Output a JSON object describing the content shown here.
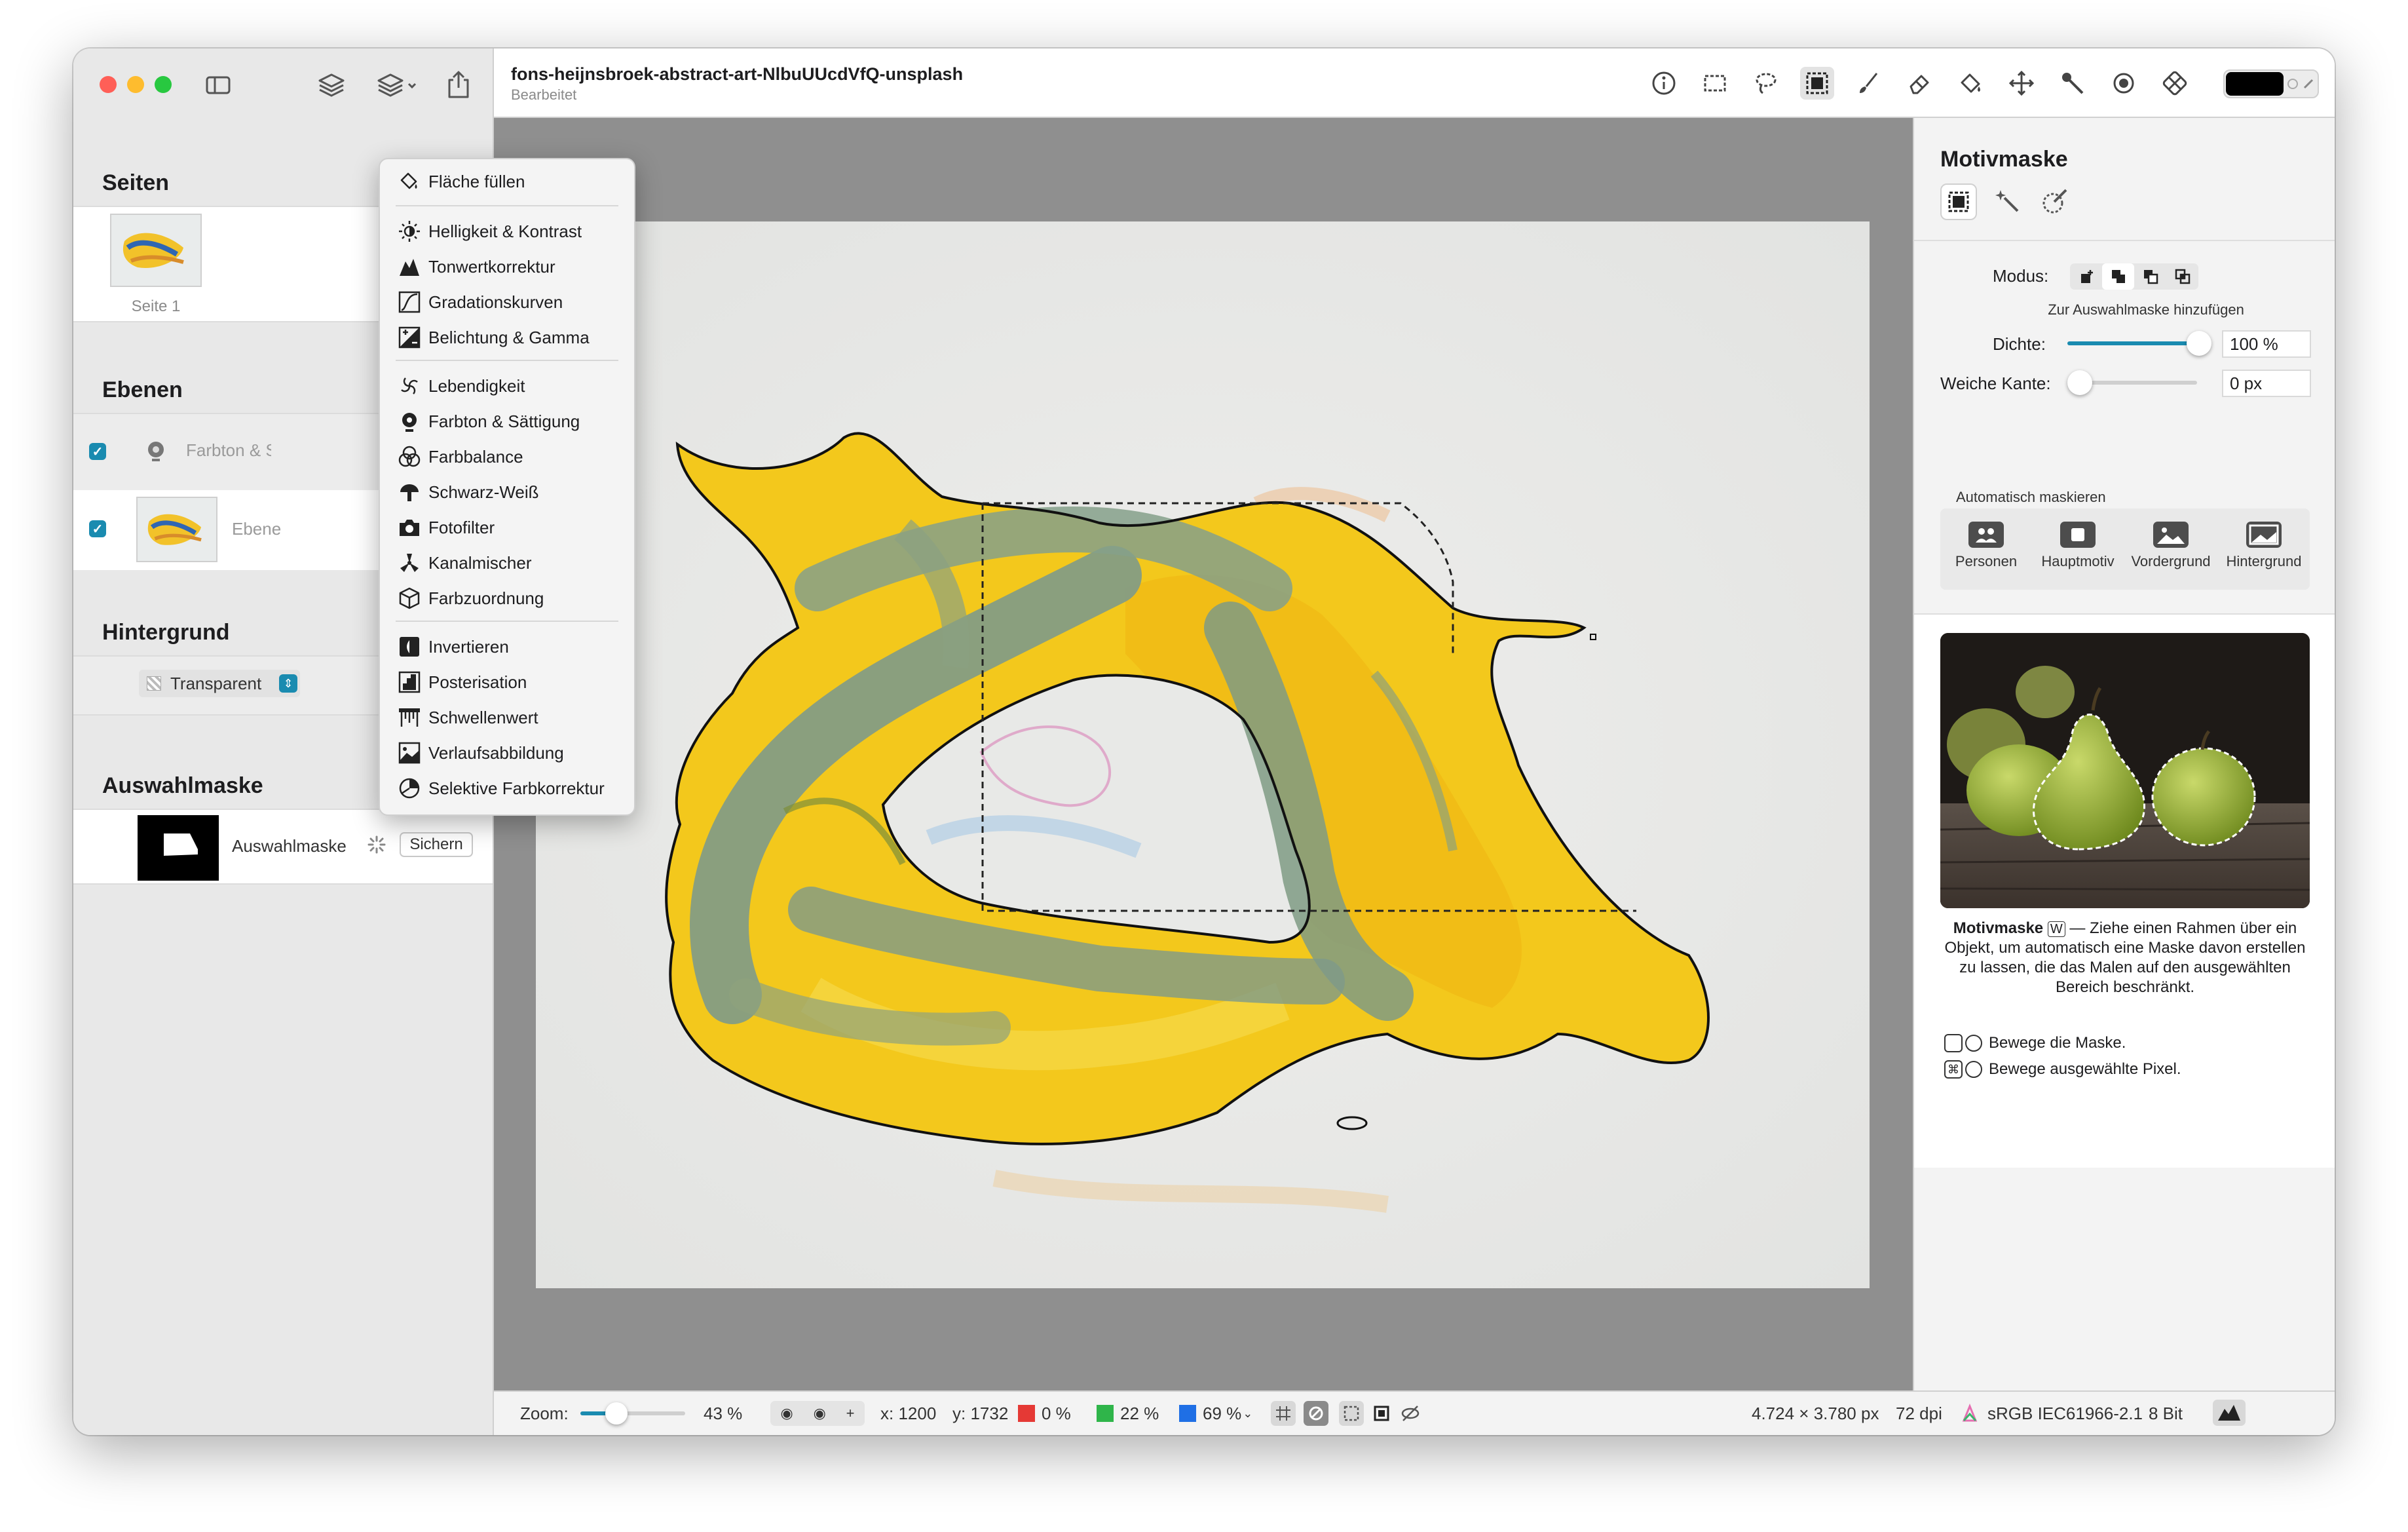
{
  "document": {
    "title": "fons-heijnsbroek-abstract-art-NlbuUUcdVfQ-unsplash",
    "subtitle": "Bearbeitet"
  },
  "sidebar": {
    "pages_title": "Seiten",
    "page_label": "Seite 1",
    "layers_title": "Ebenen",
    "layers": [
      {
        "label": "Farbton & Sättigung",
        "visible": true
      },
      {
        "label": "Ebene",
        "visible": true
      }
    ],
    "background_title": "Hintergrund",
    "background_value": "Transparent",
    "mask_title": "Auswahlmaske",
    "mask_label": "Auswahlmaske",
    "mask_save": "Sichern"
  },
  "menu": {
    "items": [
      {
        "label": "Fläche füllen",
        "icon": "bucket-icon"
      },
      {
        "label": "Helligkeit & Kontrast",
        "icon": "sun-icon"
      },
      {
        "label": "Tonwertkorrektur",
        "icon": "levels-icon"
      },
      {
        "label": "Gradationskurven",
        "icon": "curves-icon"
      },
      {
        "label": "Belichtung & Gamma",
        "icon": "exposure-icon"
      },
      {
        "label": "Lebendigkeit",
        "icon": "vibrance-icon"
      },
      {
        "label": "Farbton & Sättigung",
        "icon": "hue-icon"
      },
      {
        "label": "Farbbalance",
        "icon": "color-balance-icon"
      },
      {
        "label": "Schwarz-Weiß",
        "icon": "black-white-icon"
      },
      {
        "label": "Fotofilter",
        "icon": "camera-icon"
      },
      {
        "label": "Kanalmischer",
        "icon": "channel-mixer-icon"
      },
      {
        "label": "Farbzuordnung",
        "icon": "cube-icon"
      },
      {
        "label": "Invertieren",
        "icon": "invert-icon"
      },
      {
        "label": "Posterisation",
        "icon": "posterize-icon"
      },
      {
        "label": "Schwellenwert",
        "icon": "threshold-icon"
      },
      {
        "label": "Verlaufsabbildung",
        "icon": "gradient-map-icon"
      },
      {
        "label": "Selektive Farbkorrektur",
        "icon": "selective-color-icon"
      }
    ]
  },
  "panel": {
    "title": "Motivmaske",
    "mode_label": "Modus:",
    "mode_hint": "Zur Auswahlmaske hinzufügen",
    "density_label": "Dichte:",
    "density_value": "100 %",
    "feather_label": "Weiche Kante:",
    "feather_value": "0 px",
    "auto_label": "Automatisch maskieren",
    "auto_buttons": [
      {
        "label": "Personen",
        "icon": "people-icon"
      },
      {
        "label": "Hauptmotiv",
        "icon": "subject-icon"
      },
      {
        "label": "Vordergrund",
        "icon": "foreground-icon"
      },
      {
        "label": "Hintergrund",
        "icon": "background-icon"
      }
    ],
    "help_title": "Motivmaske",
    "help_key": "W",
    "help_text": "— Ziehe einen Rahmen über ein Objekt, um automatisch eine Maske davon erstellen zu lassen, die das Malen auf den ausgewählten Bereich beschränkt.",
    "tip1": "Bewege die Maske.",
    "tip2": "Bewege ausgewählte Pixel."
  },
  "status": {
    "zoom_label": "Zoom:",
    "zoom_value": "43 %",
    "zoom_fraction": 0.43,
    "x": "x: 1200",
    "y": "y: 1732",
    "r": "0 %",
    "g": "22 %",
    "b": "69 %",
    "dimensions": "4.724 × 3.780 px",
    "dpi": "72 dpi",
    "profile": "sRGB IEC61966-2.1",
    "bitdepth": "8 Bit"
  },
  "colors": {
    "accent": "#1a8bb0",
    "red": "#e53935",
    "green": "#2fb54a",
    "blue": "#1f6fe5",
    "paint_yellow": "#f3c81c",
    "paint_green": "#7e9a8a"
  }
}
